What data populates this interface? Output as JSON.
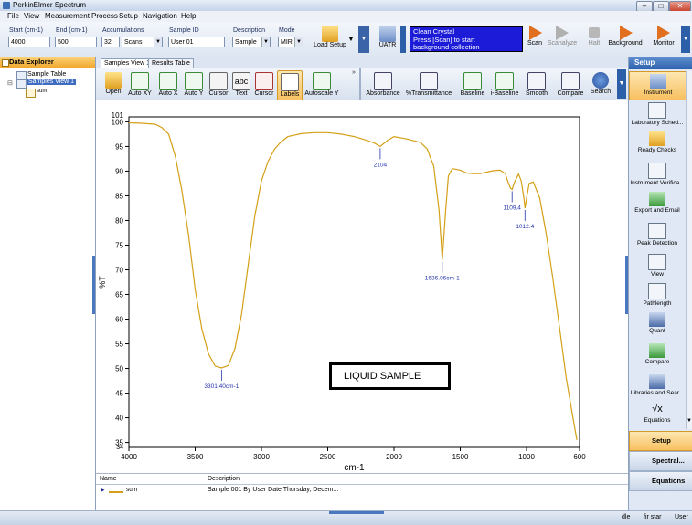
{
  "app": {
    "title": "PerkinElmer Spectrum"
  },
  "window_controls": {
    "minimize": "–",
    "maximize": "□",
    "close": "✕"
  },
  "menu": [
    "File",
    "View",
    "Measurement",
    "Process",
    "Setup",
    "Navigation",
    "Help"
  ],
  "params": {
    "start": {
      "label": "Start (cm-1)",
      "value": "4000"
    },
    "end": {
      "label": "End (cm-1)",
      "value": "500"
    },
    "accumulations": {
      "label": "Accumulations",
      "value": "32",
      "unit": "Scans"
    },
    "sample_id": {
      "label": "Sample ID",
      "value": "User 01"
    },
    "description": {
      "label": "Description",
      "value": "Sample"
    },
    "mode": {
      "label": "Mode",
      "value": "MIR"
    }
  },
  "top_actions": {
    "load_setup": "Load Setup",
    "uatr": "UATR",
    "status_text": [
      "Clean Crystal",
      "Press [Scan] to start",
      "background collection"
    ],
    "scan": "Scan",
    "scanalyze": "Scanalyze",
    "halt": "Halt",
    "background": "Background",
    "monitor": "Monitor"
  },
  "explorer": {
    "header": "Data Explorer",
    "items": [
      "Sample Table",
      "Samples View 1",
      "sum"
    ]
  },
  "tabs": [
    "Samples View 1",
    "Results Table"
  ],
  "view_tools": [
    "Open",
    "Auto XY",
    "Auto X",
    "Auto Y",
    "Cursor",
    "Text",
    "Cursor",
    "Labels",
    "Autoscale Y"
  ],
  "process_tools": [
    "Absorbance",
    "%Transmittance",
    "Baseline",
    "i-Baseline",
    "Smooth",
    "Compare",
    "Search"
  ],
  "setup_panel": {
    "header": "Setup",
    "items": [
      "Instrument",
      "Laboratory Sched...",
      "Ready Checks",
      "Instrument Verifica...",
      "Export and Email",
      "Peak Detection",
      "View",
      "Pathlength",
      "Quant",
      "Compare",
      "Libraries and Sear...",
      "Equations"
    ],
    "bottom": [
      "Setup",
      "Spectral...",
      "Equations"
    ]
  },
  "legend": {
    "headers": [
      "Name",
      "Description"
    ],
    "row": {
      "name": "sum",
      "description": "Sample 001 By User Date Thursday, Decem..."
    }
  },
  "status_bar": [
    "dle",
    "fir star",
    "User"
  ],
  "annotation": "LIQUID SAMPLE",
  "colors": {
    "spectrum": "#d4a017",
    "peak_label": "#2233aa",
    "status_box": "#1c1cd8",
    "accent": "#f1a82c"
  },
  "chart_data": {
    "type": "line",
    "xlabel": "cm-1",
    "ylabel": "%T",
    "xlim": [
      4000,
      600
    ],
    "ylim": [
      34,
      101
    ],
    "xticks": [
      4000,
      3500,
      3000,
      2500,
      2000,
      1500,
      1000,
      600
    ],
    "yticks": [
      100,
      95,
      90,
      85,
      80,
      75,
      70,
      65,
      60,
      55,
      50,
      45,
      40,
      35
    ],
    "extra_ytick_labels": [
      "101",
      "34"
    ],
    "series": [
      {
        "name": "sum",
        "x": [
          4000,
          3900,
          3800,
          3750,
          3700,
          3650,
          3600,
          3550,
          3500,
          3450,
          3400,
          3350,
          3301,
          3250,
          3200,
          3150,
          3100,
          3050,
          3000,
          2950,
          2900,
          2850,
          2800,
          2700,
          2600,
          2500,
          2400,
          2300,
          2200,
          2150,
          2104,
          2050,
          2000,
          1900,
          1800,
          1750,
          1700,
          1660,
          1636,
          1610,
          1590,
          1560,
          1500,
          1450,
          1400,
          1350,
          1300,
          1250,
          1200,
          1160,
          1140,
          1120,
          1109,
          1090,
          1060,
          1040,
          1020,
          1012,
          1000,
          980,
          950,
          900,
          850,
          800,
          750,
          700,
          650,
          620
        ],
        "y": [
          99.8,
          99.7,
          99.5,
          98.8,
          97.5,
          93.0,
          86.0,
          77.0,
          66.0,
          58.0,
          53.0,
          50.5,
          50.1,
          50.6,
          54.0,
          61.0,
          71.0,
          81.0,
          88.0,
          92.0,
          94.5,
          96.0,
          97.0,
          97.6,
          97.8,
          97.8,
          97.5,
          97.0,
          96.2,
          95.7,
          95.0,
          96.2,
          97.0,
          96.5,
          95.8,
          94.5,
          91.0,
          82.0,
          72.0,
          82.0,
          89.0,
          90.5,
          90.2,
          89.6,
          89.5,
          89.5,
          89.8,
          90.1,
          90.2,
          89.5,
          87.8,
          86.5,
          86.3,
          87.8,
          89.4,
          88.0,
          84.5,
          82.5,
          84.5,
          87.5,
          87.8,
          84.5,
          77.0,
          68.0,
          58.0,
          48.0,
          40.0,
          35.5
        ]
      }
    ],
    "annotations": [
      {
        "x": 3301,
        "y": 50.1,
        "label": "3301.40cm-1"
      },
      {
        "x": 2104,
        "y": 95.0,
        "label": "2104"
      },
      {
        "x": 1636,
        "y": 72.0,
        "label": "1636.06cm-1"
      },
      {
        "x": 1109,
        "y": 86.3,
        "label": "1109.4"
      },
      {
        "x": 1012,
        "y": 82.5,
        "label": "1012.4"
      }
    ]
  }
}
